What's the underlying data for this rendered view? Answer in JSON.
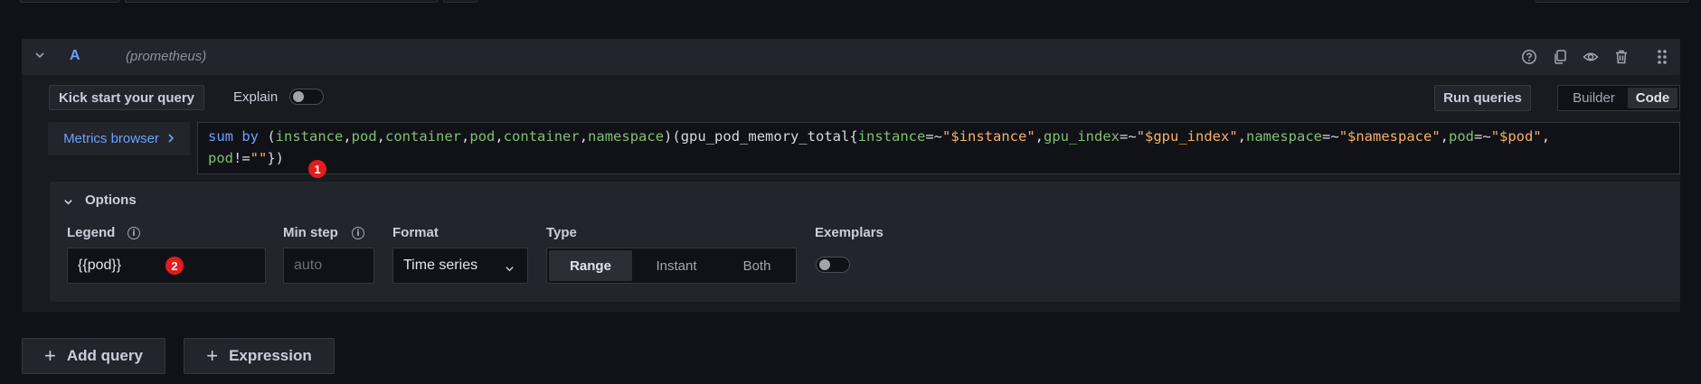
{
  "query": {
    "ref_id": "A",
    "datasource": "(prometheus)",
    "icons": [
      "help-icon",
      "duplicate-icon",
      "eye-icon",
      "trash-icon",
      "drag-handle-icon"
    ]
  },
  "toolbar": {
    "kick_start_label": "Kick start your query",
    "explain_label": "Explain",
    "run_queries_label": "Run queries",
    "mode_builder": "Builder",
    "mode_code": "Code",
    "active_mode": "Code"
  },
  "editor": {
    "metrics_browser_label": "Metrics browser",
    "line1": {
      "kw": "sum by",
      "p1": " (",
      "l1": "instance",
      "c1": ",",
      "l2": "pod",
      "c2": ",",
      "l3": "container",
      "c3": ",",
      "l4": "pod",
      "c4": ",",
      "l5": "container",
      "c5": ",",
      "l6": "namespace",
      "p2": ")(gpu_pod_memory_total{",
      "m1": "instance",
      "o1": "=~",
      "v1": "\"$instance\"",
      "c6": ",",
      "m2": "gpu_index",
      "o2": "=~",
      "v2": "\"$gpu_index\"",
      "c7": ",",
      "m3": "namespace",
      "o3": "=~",
      "v3": "\"$namespace\"",
      "c8": ",",
      "m4": "pod",
      "o4": "=~",
      "v4": "\"$pod\"",
      "c9": ","
    },
    "line2": {
      "m5": "pod",
      "o5": "!=",
      "v5": "\"\"",
      "end": "})"
    },
    "annotation_1": "1"
  },
  "options": {
    "header": "Options",
    "legend_label": "Legend",
    "legend_value": "{{pod}}",
    "annotation_2": "2",
    "min_step_label": "Min step",
    "min_step_placeholder": "auto",
    "format_label": "Format",
    "format_value": "Time series",
    "type_label": "Type",
    "type_options": [
      "Range",
      "Instant",
      "Both"
    ],
    "type_selected": "Range",
    "exemplars_label": "Exemplars",
    "exemplars_enabled": false
  },
  "actions": {
    "add_query_label": "Add query",
    "expression_label": "Expression"
  }
}
